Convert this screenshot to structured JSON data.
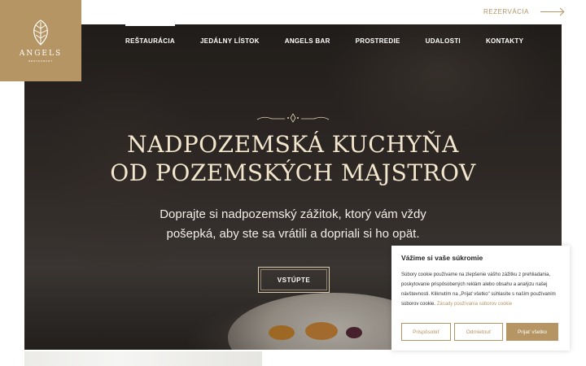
{
  "brand": {
    "name": "ANGELS",
    "tagline": "RESTAURANT"
  },
  "top_link": {
    "label": "REZERVÁCIA"
  },
  "nav": [
    {
      "label": "REŠTAURÁCIA",
      "active": true
    },
    {
      "label": "JEDÁLNY LÍSTOK"
    },
    {
      "label": "ANGELS BAR"
    },
    {
      "label": "PROSTREDIE"
    },
    {
      "label": "UDALOSTI"
    },
    {
      "label": "KONTAKTY"
    }
  ],
  "hero": {
    "headline_line1": "NADPOZEMSKÁ KUCHYŇA",
    "headline_line2": "OD POZEMSKÝCH MAJSTROV",
    "sub_line1": "Doprajte si nadpozemský zážitok, ktorý vám vždy",
    "sub_line2": "pošepká, aby ste sa vrátili a dopriali si ho opät.",
    "cta": "VSTÚPTE"
  },
  "cookie": {
    "title": "Vážime si vaše súkromie",
    "body": "Súbory cookie používame na zlepšenie vášho zážitku z prehliadania, poskytovanie prispôsobených reklám alebo obsahu a analýzu našej návštevnosti. Kliknutím na „Prijať všetko\" súhlasíte s naším používaním súborov cookie.",
    "link": "Zásady používania súborov cookie",
    "btn_customize": "Prispôsobiť",
    "btn_reject": "Odmietnuť",
    "btn_accept": "Prijať všetko"
  },
  "colors": {
    "accent": "#b59563",
    "headline": "#f3e6cd"
  }
}
